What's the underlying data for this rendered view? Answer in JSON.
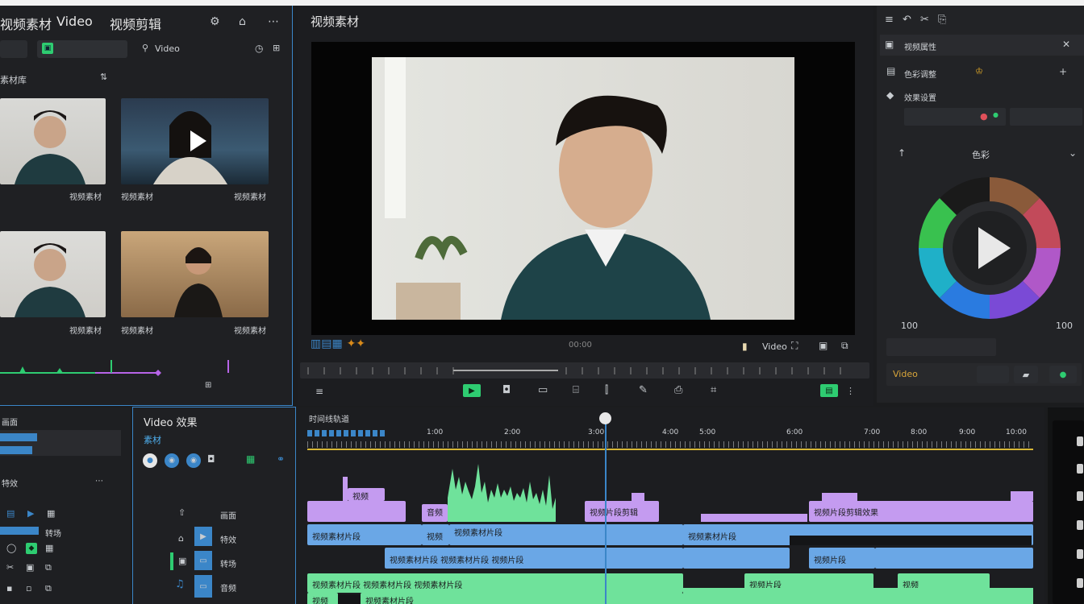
{
  "app": {
    "title": "视频素材",
    "menu": [
      "Video",
      "视频剪辑"
    ]
  },
  "media": {
    "search_value": "Video",
    "section_label": "素材库",
    "items": [
      {
        "label": "视频素材"
      },
      {
        "label": "视频素材"
      },
      {
        "label": "视频素材"
      },
      {
        "label": "视频素材"
      },
      {
        "label": "视频素材"
      },
      {
        "label": "视频素材"
      }
    ]
  },
  "preview": {
    "title": "视频素材",
    "timecode": "00:00",
    "format_label": "Video"
  },
  "inspector": {
    "rows": [
      "视频属性",
      "色彩调整",
      "效果设置"
    ],
    "wheel_label": "色彩",
    "left_value": "100",
    "right_value": "100",
    "preset_label": "Video"
  },
  "effects": {
    "title": "Video 效果",
    "tab": "素材",
    "items": [
      "画面",
      "特效",
      "转场",
      "音频"
    ]
  },
  "timeline": {
    "title": "时间线轨道",
    "ruler": [
      "1:00",
      "2:00",
      "3:00",
      "4:00",
      "5:00",
      "6:00",
      "7:00",
      "8:00",
      "9:00",
      "10:00"
    ],
    "clips": {
      "p1": "视频",
      "p2": "音频",
      "p3": "视频片段剪辑",
      "p4": "视频片段剪辑效果",
      "b1": "视频素材片段",
      "b2": "视频",
      "b3": "视频素材片段",
      "b4": "视频素材片段 视频素材片段 视频片段",
      "b5": "视频片段",
      "g1": "视频素材片段 视频素材片段 视频素材片段",
      "g2": "视频",
      "g3": "视频素材片段",
      "g4": "视频片段",
      "g5": "视频"
    }
  },
  "colors": {
    "accent_blue": "#3b86c8",
    "clip_purple": "#c49bf0",
    "clip_blue": "#6aa7e6",
    "clip_green": "#6fe29b",
    "play_green": "#2ecc71"
  }
}
